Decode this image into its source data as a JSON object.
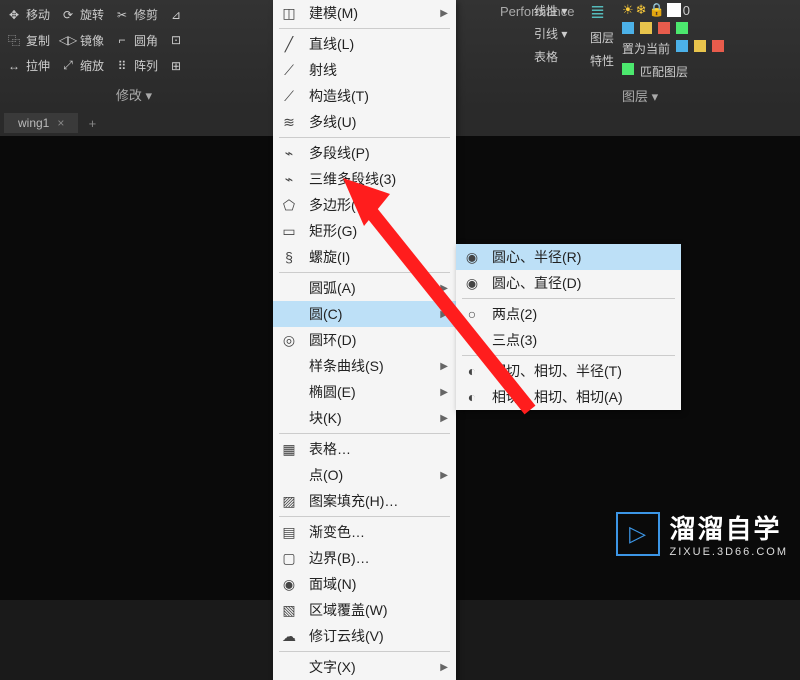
{
  "ribbon": {
    "group_modify_label": "修改 ▾",
    "tools": {
      "move": "移动",
      "rotate": "旋转",
      "trim": "修剪",
      "copy": "复制",
      "mirror": "镜像",
      "fillet": "圆角",
      "stretch": "拉伸",
      "scale": "缩放",
      "array": "阵列"
    },
    "right": {
      "xianxing": "线性 ▾",
      "yinxian": "引线 ▾",
      "biaoge": "表格",
      "tuceng": "图层",
      "texing": "特性",
      "zhiwei": "置为当前",
      "pipei": "匹配图层",
      "tuceng_panel": "图层 ▾"
    },
    "perf": "Performance"
  },
  "tab": {
    "name": "wing1"
  },
  "menu": {
    "items": [
      {
        "icon": "cube",
        "label": "建模(M)",
        "arrow": true
      },
      {
        "sep": true
      },
      {
        "icon": "line",
        "label": "直线(L)"
      },
      {
        "icon": "ray",
        "label": "射线"
      },
      {
        "icon": "xline",
        "label": "构造线(T)"
      },
      {
        "icon": "mline",
        "label": "多线(U)"
      },
      {
        "sep": true
      },
      {
        "icon": "pline",
        "label": "多段线(P)"
      },
      {
        "icon": "pline3d",
        "label": "三维多段线(3)"
      },
      {
        "icon": "polygon",
        "label": "多边形(Y)"
      },
      {
        "icon": "rect",
        "label": "矩形(G)"
      },
      {
        "icon": "helix",
        "label": "螺旋(I)"
      },
      {
        "sep": true
      },
      {
        "icon": "",
        "label": "圆弧(A)",
        "arrow": true
      },
      {
        "icon": "",
        "label": "圆(C)",
        "arrow": true,
        "highlighted": true
      },
      {
        "icon": "donut",
        "label": "圆环(D)"
      },
      {
        "icon": "",
        "label": "样条曲线(S)",
        "arrow": true
      },
      {
        "icon": "",
        "label": "椭圆(E)",
        "arrow": true
      },
      {
        "icon": "",
        "label": "块(K)",
        "arrow": true
      },
      {
        "sep": true
      },
      {
        "icon": "table",
        "label": "表格…"
      },
      {
        "icon": "",
        "label": "点(O)",
        "arrow": true
      },
      {
        "icon": "hatch",
        "label": "图案填充(H)…"
      },
      {
        "sep": true
      },
      {
        "icon": "grad",
        "label": "渐变色…"
      },
      {
        "icon": "boundary",
        "label": "边界(B)…"
      },
      {
        "icon": "region",
        "label": "面域(N)"
      },
      {
        "icon": "wipeout",
        "label": "区域覆盖(W)"
      },
      {
        "icon": "revcloud",
        "label": "修订云线(V)"
      },
      {
        "sep": true
      },
      {
        "icon": "",
        "label": "文字(X)",
        "arrow": true
      }
    ]
  },
  "submenu": {
    "items": [
      {
        "icon": "cr",
        "label": "圆心、半径(R)",
        "highlighted": true
      },
      {
        "icon": "cd",
        "label": "圆心、直径(D)"
      },
      {
        "sep": true
      },
      {
        "icon": "2p",
        "label": "两点(2)"
      },
      {
        "icon": "3p",
        "label": "三点(3)"
      },
      {
        "sep": true
      },
      {
        "icon": "ttr",
        "label": "相切、相切、半径(T)"
      },
      {
        "icon": "tta",
        "label": "相切、相切、相切(A)"
      }
    ]
  },
  "watermark": {
    "title": "溜溜自学",
    "sub": "ZIXUE.3D66.COM"
  }
}
